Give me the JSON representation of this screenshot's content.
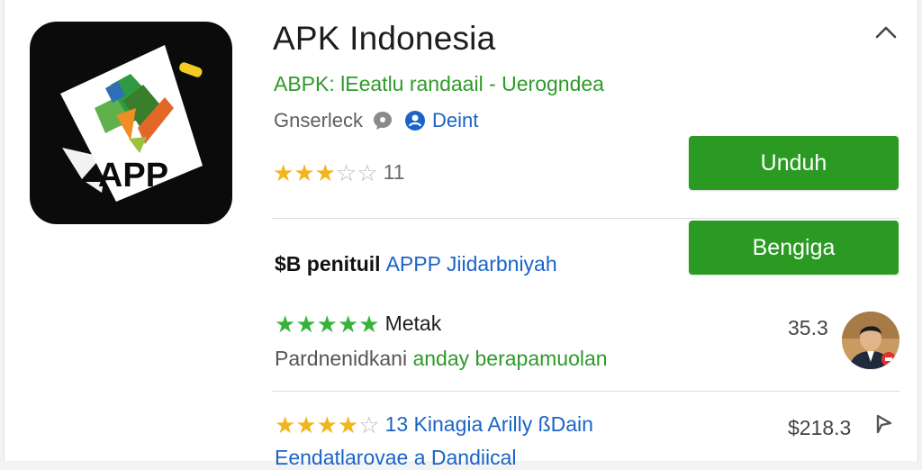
{
  "app": {
    "title": "APK Indonesia",
    "subtitle": "ABPK: lEeatlu randaail - Uerogndea",
    "developer": "Gnserleck",
    "developer_link": "Deint",
    "icon_text": "APP",
    "rating_count": "11",
    "rating_stars": 3
  },
  "buttons": {
    "download": "Unduh",
    "secondary": "Bengiga"
  },
  "section": {
    "title_bold": "$B penituil",
    "title_link": "APPP Jiidarbniyah"
  },
  "reviews": [
    {
      "name": "Metak",
      "stars": 5,
      "value": "35.3",
      "text_gray": "Pardnenidkani ",
      "text_green": "anday berapamuolan"
    },
    {
      "name": "13 Kinagia Arilly ßDain",
      "stars": 4,
      "value": "$218.3",
      "text": "Eendatlarovae a Dandiical"
    }
  ],
  "colors": {
    "accent_green": "#2a9a23",
    "link_blue": "#1a64c7",
    "star_gold": "#f2b51b",
    "star_green": "#36b43a"
  },
  "icons": [
    "chevron-up-icon",
    "chat-bubble-icon",
    "developer-badge-icon",
    "star-icon",
    "share-icon",
    "avatar"
  ]
}
